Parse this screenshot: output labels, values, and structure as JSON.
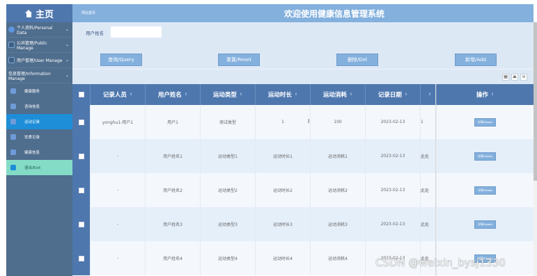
{
  "sidebar": {
    "brand": "主页",
    "groups": [
      {
        "label": "个人资料/Personal Data"
      },
      {
        "label": "公共管理/Public Manage"
      },
      {
        "label": "用户管理/User Manage"
      },
      {
        "label": "信息管理/Information Manage"
      }
    ],
    "items": [
      {
        "label": "健康服务"
      },
      {
        "label": "咨询信息"
      },
      {
        "label": "运动记录"
      },
      {
        "label": "饮食记录"
      },
      {
        "label": "健康信息"
      },
      {
        "label": "退出/Exit"
      }
    ]
  },
  "header": {
    "breadcrumb": "网站首页",
    "title": "欢迎使用健康信息管理系统"
  },
  "search": {
    "label": "用户姓名",
    "value": "",
    "buttons": {
      "query": "查询/Query",
      "reset": "重置/Reset",
      "del": "删除/Del",
      "add": "新增/Add"
    }
  },
  "toolbar": {
    "icons": [
      "grid-icon",
      "print-icon",
      "minus-icon"
    ]
  },
  "table": {
    "columns": [
      "记录人员",
      "用户姓名",
      "运动类型",
      "运动时长",
      "运动消耗",
      "记录日期",
      "",
      "操作"
    ],
    "sort_glyph": "⇕",
    "rows": [
      [
        "yonghu1-用户1",
        "用户1",
        "测试类型",
        "1",
        "100",
        "2023-02-13",
        "1",
        "详情/Details"
      ],
      [
        "-",
        "用户姓名1",
        "运动类型1",
        "运动时长1",
        "运动消耗1",
        "2023-02-13",
        "此处",
        "详情/Details"
      ],
      [
        "-",
        "用户姓名2",
        "运动类型2",
        "运动时长2",
        "运动消耗2",
        "2023-02-13",
        "此处",
        "详情/Details"
      ],
      [
        "-",
        "用户姓名3",
        "运动类型3",
        "运动时长3",
        "运动消耗3",
        "2023-02-13",
        "此处",
        "详情/Details"
      ],
      [
        "-",
        "用户姓名4",
        "运动类型4",
        "运动时长4",
        "运动消耗4",
        "2023-02-13",
        "此处",
        "详情/Details"
      ]
    ]
  },
  "watermark": "CSDN @weixin_bysj1330"
}
